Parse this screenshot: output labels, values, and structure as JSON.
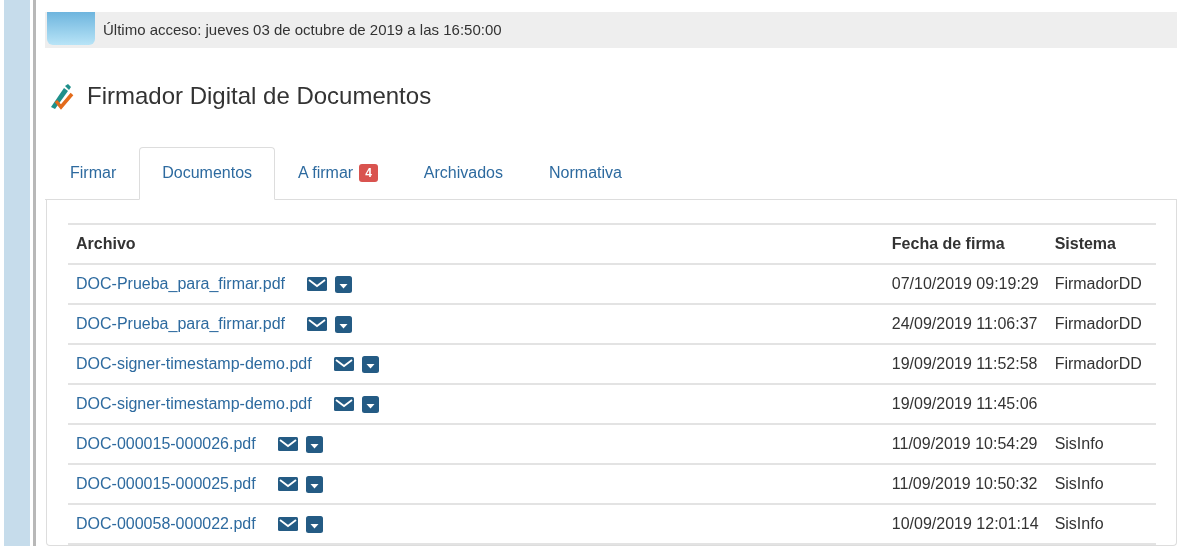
{
  "user": {
    "last_access": "Último acceso: jueves 03 de octubre de 2019 a las 16:50:00"
  },
  "page": {
    "title": "Firmador Digital de Documentos"
  },
  "tabs": [
    {
      "label": "Firmar",
      "selected": false
    },
    {
      "label": "Documentos",
      "selected": true
    },
    {
      "label": "A firmar",
      "selected": false,
      "badge": "4"
    },
    {
      "label": "Archivados",
      "selected": false
    },
    {
      "label": "Normativa",
      "selected": false
    }
  ],
  "table": {
    "columns": [
      "Archivo",
      "Fecha de firma",
      "Sistema"
    ],
    "rows": [
      {
        "file": "DOC-Prueba_para_firmar.pdf",
        "date": "07/10/2019 09:19:29",
        "system": "FirmadorDD"
      },
      {
        "file": "DOC-Prueba_para_firmar.pdf",
        "date": "24/09/2019 11:06:37",
        "system": "FirmadorDD"
      },
      {
        "file": "DOC-signer-timestamp-demo.pdf",
        "date": "19/09/2019 11:52:58",
        "system": "FirmadorDD"
      },
      {
        "file": "DOC-signer-timestamp-demo.pdf",
        "date": "19/09/2019 11:45:06"
      },
      {
        "file": "DOC-000015-000026.pdf",
        "date": "11/09/2019 10:54:29",
        "system": "SisInfo"
      },
      {
        "file": "DOC-000015-000025.pdf",
        "date": "11/09/2019 10:50:32",
        "system": "SisInfo"
      },
      {
        "file": "DOC-000058-000022.pdf",
        "date": "10/09/2019 12:01:14",
        "system": "SisInfo"
      }
    ]
  }
}
